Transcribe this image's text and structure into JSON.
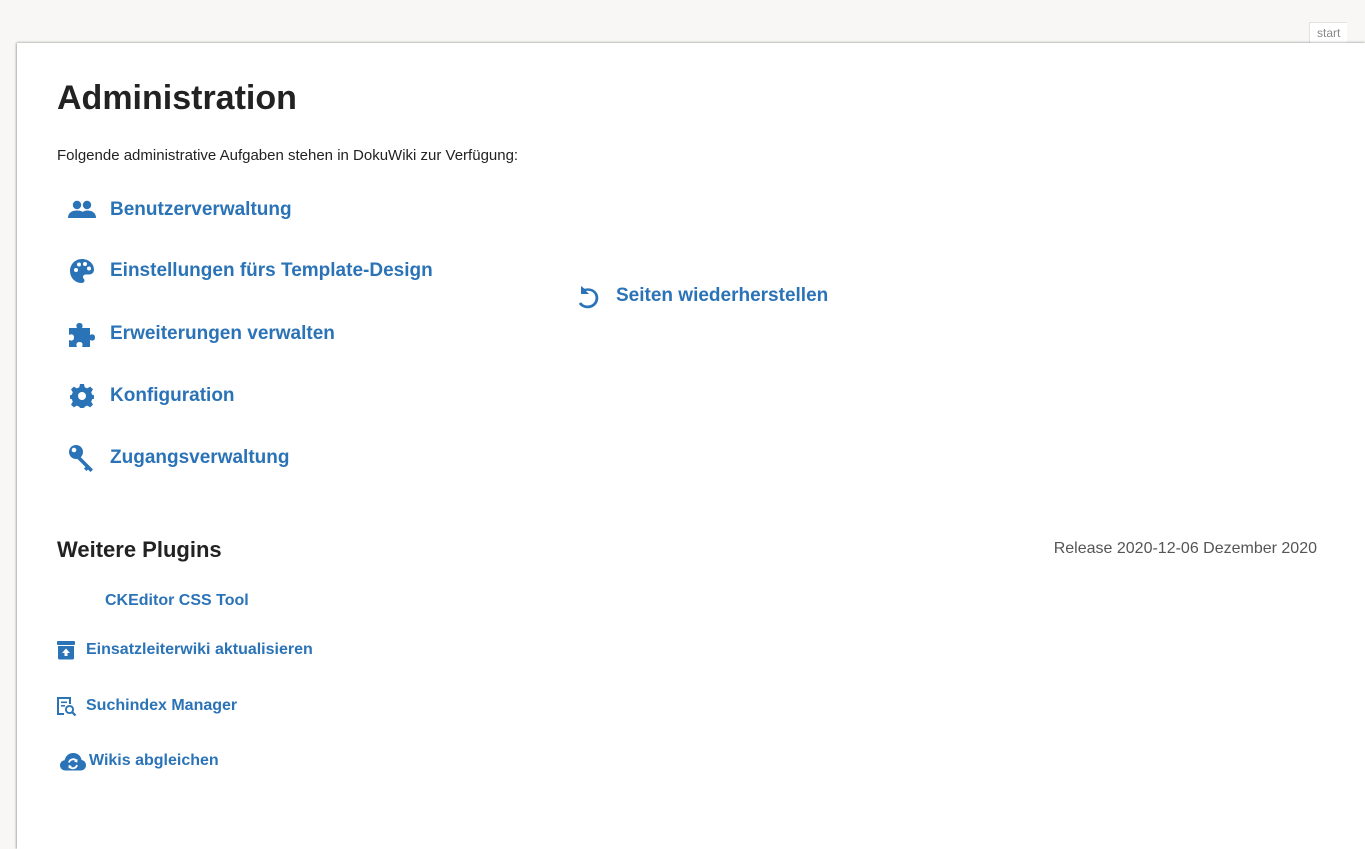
{
  "page_id": "start",
  "title": "Administration",
  "intro": "Folgende administrative Aufgaben stehen in DokuWiki zur Verfügung:",
  "admin_tasks": [
    {
      "label": "Benutzerverwaltung",
      "icon": "users-icon"
    },
    {
      "label": "Einstellungen fürs Template-Design",
      "icon": "palette-icon"
    },
    {
      "label": "Erweiterungen verwalten",
      "icon": "puzzle-icon"
    },
    {
      "label": "Konfiguration",
      "icon": "gear-icon"
    },
    {
      "label": "Zugangsverwaltung",
      "icon": "key-icon"
    },
    {
      "label": "Seiten wiederherstellen",
      "icon": "undo-icon"
    }
  ],
  "more_plugins": {
    "title": "Weitere Plugins",
    "items": [
      {
        "label": "CKEditor CSS Tool",
        "icon": ""
      },
      {
        "label": "Einsatzleiterwiki aktualisieren",
        "icon": "upload-box-icon"
      },
      {
        "label": "Suchindex Manager",
        "icon": "search-document-icon"
      },
      {
        "label": "Wikis abgleichen",
        "icon": "cloud-sync-icon"
      }
    ]
  },
  "version": "Release 2020-12-06 Dezember 2020",
  "colors": {
    "link": "#2b73b7",
    "text": "#222222",
    "background": "#f8f7f5"
  }
}
